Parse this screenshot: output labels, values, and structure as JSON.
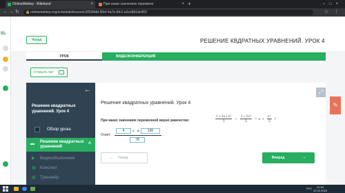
{
  "browser": {
    "tabs": [
      {
        "label": "OnlineMektep - Bilimland",
        "active": true
      },
      {
        "label": "При каких значениях переменн",
        "active": false
      }
    ],
    "url": "onlinemektep.org/schedule/lesson/c20594dd-50ef-4a7e-bfc1-a2ce8d1dc403"
  },
  "app": {
    "logo": "BL",
    "back_label": "Назад",
    "page_title": "РЕШЕНИЕ КВДРАТНЫХ УРАВНЕНИЙ. УРОК 4",
    "tabs": {
      "lesson": "УРОК",
      "video": "ВИДЕОКОНФЕРЕНЦИЯ"
    },
    "open_chat_label": "Открыть чат"
  },
  "sidebar": {
    "title": "Решение квадратных уравнений. Урок 4",
    "overview": "Обзор урока",
    "active_section": "Решение квадратных уравнений",
    "sub_items": [
      "Видеообъяснение",
      "Конспект",
      "Тренажёр"
    ]
  },
  "main": {
    "lesson_title": "Решение квадратных уравнений. Урок 4",
    "question": "При каких значениях переменной верно равенство:",
    "formula": {
      "frac1_num": "1+3x+x²",
      "frac1_den": "5",
      "minus": "−",
      "frac2_num": "1−3x²",
      "frac2_den": "5",
      "rhs": "= x +",
      "frac3_num": "x²",
      "frac3_den": "5",
      "q": "?"
    },
    "answer_label": "Ответ:",
    "answer": {
      "box1": "4",
      "pm": "±",
      "box2": "130",
      "den": "78",
      "var": "x",
      "comma": ","
    },
    "prev_label": "Назад",
    "next_label": "Вперед"
  },
  "taskbar": {
    "lang": "РУС",
    "time": "21:04",
    "date": "22.11.2020"
  },
  "colors": {
    "accent": "#27ae60",
    "panel": "#2f4353",
    "feedback": "#e8735a"
  }
}
